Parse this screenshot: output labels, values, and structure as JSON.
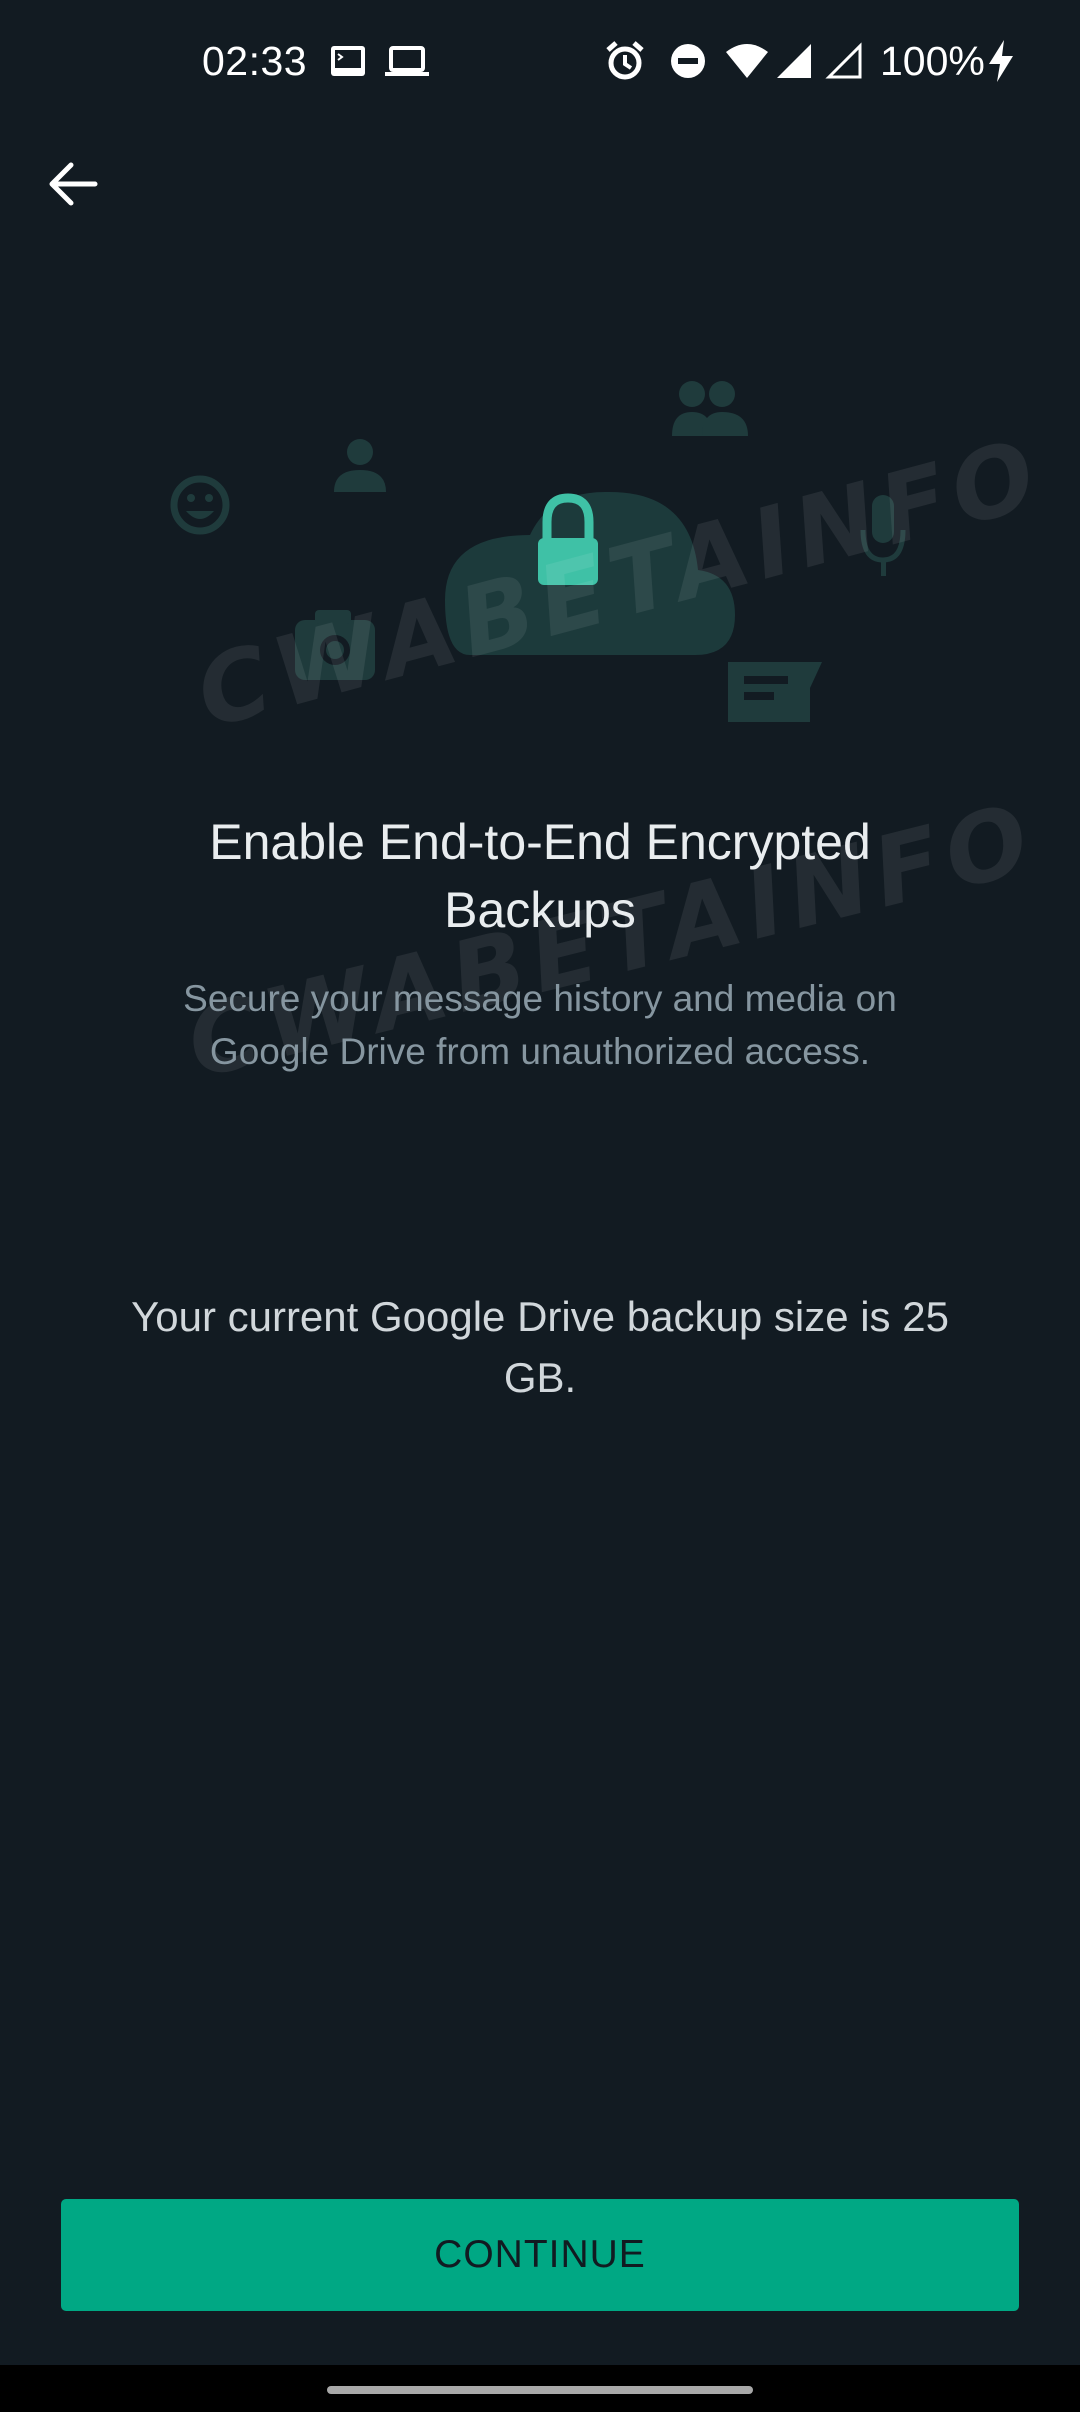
{
  "status_bar": {
    "time": "02:33",
    "battery": "100%",
    "icons": [
      "terminal-icon",
      "laptop-icon",
      "alarm-icon",
      "do-not-disturb-icon",
      "wifi-icon",
      "signal-icon",
      "signal-outline-icon",
      "charging-icon"
    ]
  },
  "header": {
    "back_icon": "arrow-back-icon"
  },
  "illustration": {
    "icons": [
      "emoji-icon",
      "person-icon",
      "group-icon",
      "cloud-icon",
      "lock-icon",
      "mic-icon",
      "camera-icon",
      "chat-bubble-icon"
    ],
    "accent": "#1f3b3c",
    "lock_color": "#3fc1a6"
  },
  "main": {
    "title": "Enable End-to-End Encrypted Backups",
    "subtitle": "Secure your message history and media on Google Drive from unauthorized access.",
    "backup_size_text": "Your current Google Drive backup size is 25 GB."
  },
  "watermark": {
    "text": "CWABETAINFO"
  },
  "footer": {
    "continue_label": "CONTINUE"
  },
  "colors": {
    "background": "#121b22",
    "accent": "#00a884",
    "text_primary": "#e9edef",
    "text_secondary": "#8696a0"
  }
}
